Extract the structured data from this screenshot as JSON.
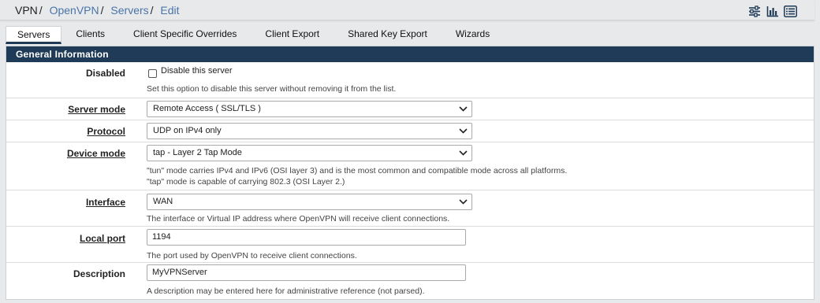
{
  "breadcrumb": {
    "root": "VPN",
    "items": [
      "OpenVPN",
      "Servers",
      "Edit"
    ],
    "separator": "/"
  },
  "header_icons": [
    "settings-sliders-icon",
    "bar-chart-icon",
    "list-icon"
  ],
  "tabs": [
    {
      "label": "Servers",
      "active": true
    },
    {
      "label": "Clients",
      "active": false
    },
    {
      "label": "Client Specific Overrides",
      "active": false
    },
    {
      "label": "Client Export",
      "active": false
    },
    {
      "label": "Shared Key Export",
      "active": false
    },
    {
      "label": "Wizards",
      "active": false
    }
  ],
  "panel": {
    "title": "General Information"
  },
  "fields": {
    "disabled": {
      "label": "Disabled",
      "checkbox_label": "Disable this server",
      "checked": false,
      "help": "Set this option to disable this server without removing it from the list."
    },
    "server_mode": {
      "label": "Server mode",
      "value": "Remote Access ( SSL/TLS )"
    },
    "protocol": {
      "label": "Protocol",
      "value": "UDP on IPv4 only"
    },
    "device_mode": {
      "label": "Device mode",
      "value": "tap - Layer 2 Tap Mode",
      "help_line1": "\"tun\" mode carries IPv4 and IPv6 (OSI layer 3) and is the most common and compatible mode across all platforms.",
      "help_line2": "\"tap\" mode is capable of carrying 802.3 (OSI Layer 2.)"
    },
    "interface": {
      "label": "Interface",
      "value": "WAN",
      "help": "The interface or Virtual IP address where OpenVPN will receive client connections."
    },
    "local_port": {
      "label": "Local port",
      "value": "1194",
      "help": "The port used by OpenVPN to receive client connections."
    },
    "description": {
      "label": "Description",
      "value": "MyVPNServer",
      "help": "A description may be entered here for administrative reference (not parsed)."
    }
  },
  "colors": {
    "panel_header_bg": "#1f3b57",
    "link": "#4a74a8",
    "page_bg": "#e8e9eb"
  }
}
